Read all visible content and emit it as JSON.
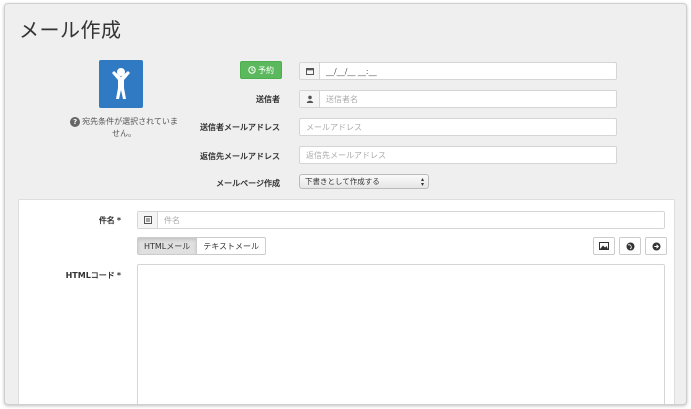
{
  "page": {
    "title": "メール作成"
  },
  "help": {
    "text": "宛先条件が選択されていません。"
  },
  "form": {
    "reserve_label": "予約",
    "datetime_placeholder": "__/__/__ __:__",
    "sender_label": "送信者",
    "sender_placeholder": "送信者名",
    "sender_email_label": "送信者メールアドレス",
    "sender_email_placeholder": "メールアドレス",
    "reply_email_label": "返信先メールアドレス",
    "reply_email_placeholder": "返信先メールアドレス",
    "mail_page_label": "メールページ作成",
    "mail_page_selected": "下書きとして作成する"
  },
  "editor": {
    "subject_label": "件名",
    "subject_placeholder": "件名",
    "tabs": [
      "HTMLメール",
      "テキストメール"
    ],
    "html_code_label": "HTMLコード",
    "required_mark": "*",
    "tools": [
      "image-icon",
      "globe-icon",
      "arrow-right-icon"
    ]
  },
  "colors": {
    "reserve_button": "#5cb85c",
    "avatar_bg": "#2f7ac3"
  }
}
